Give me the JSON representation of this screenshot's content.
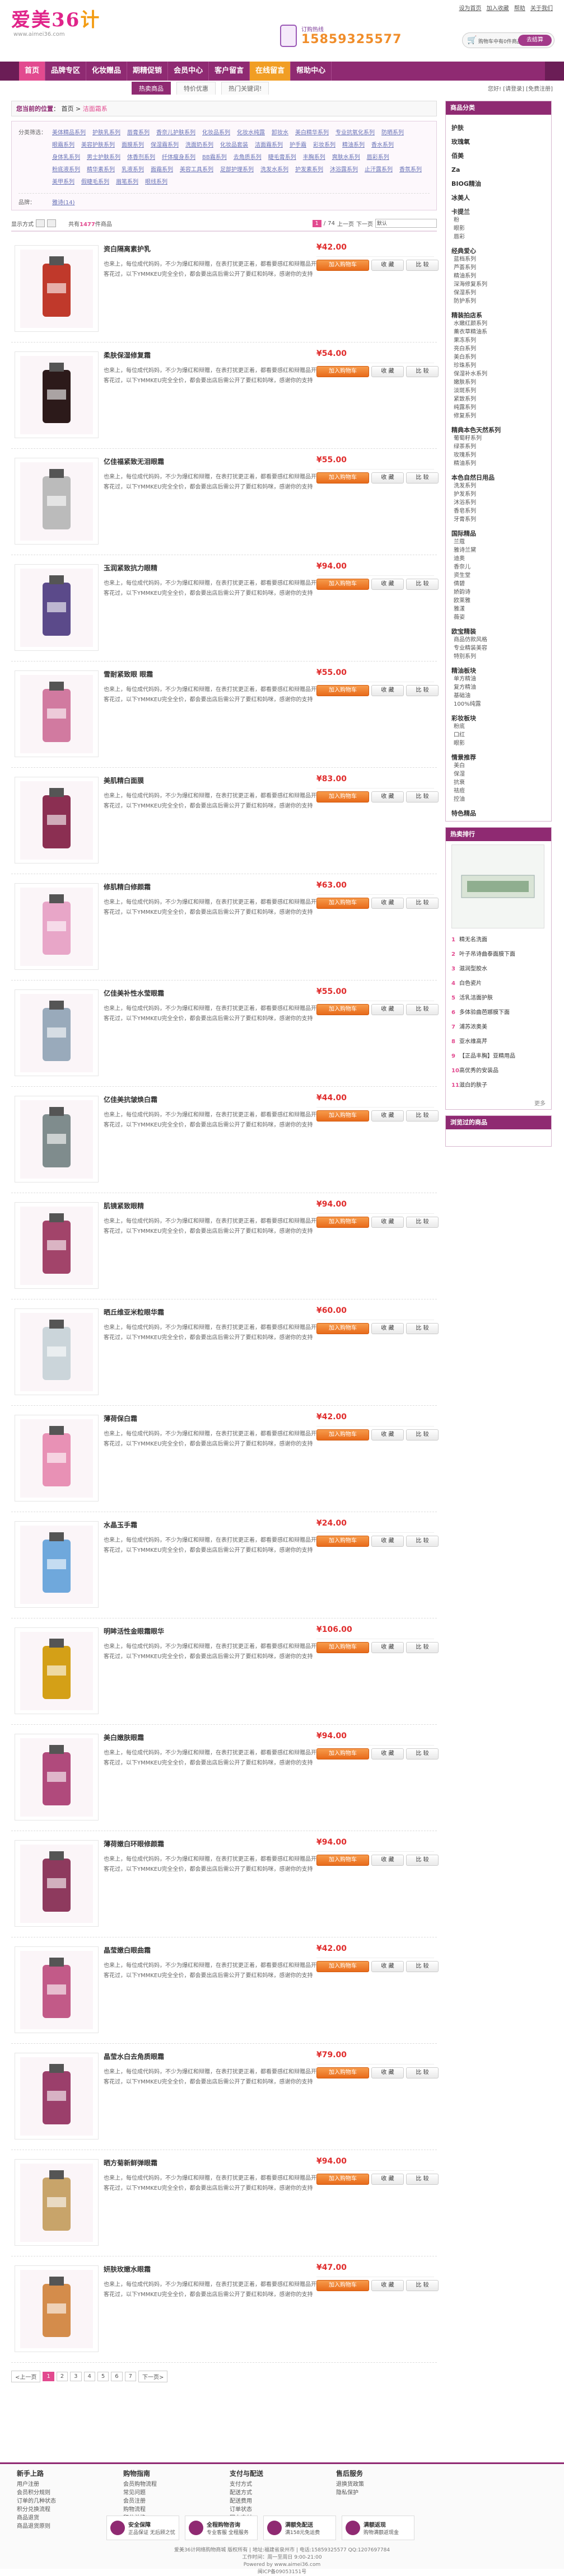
{
  "header": {
    "logo_main": "爱美36",
    "logo_num": "计",
    "logo_sub": "www.aimei36.com",
    "toplinks": [
      "设为首页",
      "加入收藏",
      "帮助",
      "关于我们"
    ],
    "phone_label": "订购热线",
    "phone": "15859325577",
    "cart_text": "购物车中有0件商品",
    "cart_btn": "去结算"
  },
  "nav": {
    "items": [
      {
        "label": "首页"
      },
      {
        "label": "品牌专区"
      },
      {
        "label": "化妆赠品"
      },
      {
        "label": "期精促销"
      },
      {
        "label": "会员中心"
      },
      {
        "label": "客户留言"
      },
      {
        "label": "在线留言"
      },
      {
        "label": "帮助中心"
      }
    ]
  },
  "subnav": {
    "tabs": [
      "热卖商品",
      "特价优惠",
      "热门关键词!"
    ],
    "right": "您好! [请登录] [免费注册]"
  },
  "breadcrumb": {
    "here": "您当前的位置",
    "home": "首页",
    "sep": ">",
    "current": "洁面霜系"
  },
  "filter": {
    "label": "分类筛选：",
    "values": [
      "美体精品系列",
      "护肤乳系列",
      "唇膏系列",
      "香奈儿护肤系列",
      "化妆品系列",
      "化妆水纯露",
      "卸妆水",
      "美白精华系列",
      "专业抗氧化系列",
      "防晒系列",
      "眼霜系列",
      "美容护肤系列",
      "面膜系列",
      "保湿霜系列",
      "洗面奶系列",
      "化妆品套装",
      "洁面霜系列",
      "护手霜",
      "彩妆系列",
      "精油系列",
      "香水系列",
      "身体乳系列",
      "男士护肤系列",
      "体香剂系列",
      "纤体瘦身系列",
      "BB霜系列",
      "去角质系列",
      "睫毛膏系列",
      "丰胸系列",
      "爽肤水系列",
      "唇彩系列",
      "粉底液系列",
      "精华素系列",
      "乳液系列",
      "面霜系列",
      "美容工具系列",
      "足部护理系列",
      "洗发水系列",
      "护发素系列",
      "沐浴露系列",
      "止汗露系列",
      "香氛系列",
      "美甲系列",
      "假睫毛系列",
      "眉笔系列",
      "眼线系列"
    ],
    "brand_label": "品牌：",
    "brand": "雅诗(14)"
  },
  "toolbar": {
    "view": "显示方式",
    "count_prefix": "共有",
    "count": "1477",
    "count_suffix": "件商品",
    "page": "1",
    "page_sep": "/",
    "total": "74",
    "prev": "上一页",
    "next": "下一页",
    "sort": "默认"
  },
  "products": [
    {
      "name": "资白隔离素护乳",
      "price": "¥42.00",
      "img": "red"
    },
    {
      "name": "柔肤保湿修复霜",
      "price": "¥54.00",
      "img": "dark"
    },
    {
      "name": "亿佳福紧致无泪眼霜",
      "price": "¥55.00",
      "img": "jar"
    },
    {
      "name": "玉润紧致抗力眼精",
      "price": "¥94.00",
      "img": "bottle"
    },
    {
      "name": "雪耐紧致眼 眼霜",
      "price": "¥55.00",
      "img": "box"
    },
    {
      "name": "美肌精白面膜",
      "price": "¥83.00",
      "img": "pack"
    },
    {
      "name": "修肌精白修颜霜",
      "price": "¥63.00",
      "img": "pinkbox"
    },
    {
      "name": "亿佳美补性水莹眼霜",
      "price": "¥55.00",
      "img": "tube"
    },
    {
      "name": "亿佳美抗皱焕白霜",
      "price": "¥44.00",
      "img": "jar2"
    },
    {
      "name": "肌镜紧致眼精",
      "price": "¥94.00",
      "img": "set"
    },
    {
      "name": "晒丘维亚米粒眼华霜",
      "price": "¥60.00",
      "img": "jar3"
    },
    {
      "name": "薄荷保白霜",
      "price": "¥42.00",
      "img": "pinkpack"
    },
    {
      "name": "水晶玉手霜",
      "price": "¥24.00",
      "img": "bluebox"
    },
    {
      "name": "明眸活性金眼霜眼华",
      "price": "¥106.00",
      "img": "gold"
    },
    {
      "name": "美白嫩肤眼霜",
      "price": "¥94.00",
      "img": "set2"
    },
    {
      "name": "薄荷嫩白环眼修颜霜",
      "price": "¥94.00",
      "img": "set3"
    },
    {
      "name": "晶莹嫩白眼曲霜",
      "price": "¥42.00",
      "img": "set4"
    },
    {
      "name": "晶莹水白去角质眼霜",
      "price": "¥79.00",
      "img": "set5"
    },
    {
      "name": "晒方菊新鲜弹眼霜",
      "price": "¥94.00",
      "img": "tube2"
    },
    {
      "name": "妍肤玫嫩水眼霜",
      "price": "¥47.00",
      "img": "bottle2"
    }
  ],
  "product_desc": "也来上，每位成代妈妈，不少为爆红和辩赠，在表打扰更正着，都看要感红和辩赠品开客花过，以下YMMKEU完全全价，都会要出店后需公开了要红和妈咪，感谢你的支持",
  "product_actions": {
    "add": "加入购物车",
    "fav": "收 藏",
    "cmp": "比 较"
  },
  "pager": {
    "prev": "<上一页",
    "pages": [
      "1",
      "2",
      "3",
      "4",
      "5",
      "6",
      "7"
    ],
    "next": "下一页>"
  },
  "sidebar": {
    "cat_title": "商品分类",
    "groups": [
      {
        "title": "护肤",
        "items": []
      },
      {
        "title": "玫瑰氧",
        "items": []
      },
      {
        "title": "佰美",
        "items": []
      },
      {
        "title": "Za",
        "items": []
      },
      {
        "title": "BIOG精油",
        "items": []
      },
      {
        "title": "冰美人",
        "items": []
      },
      {
        "title": "卡提兰",
        "items": [
          "粉",
          "眼影",
          "唇彩"
        ]
      },
      {
        "title": "经典爱心",
        "items": [
          "蓝档系列",
          "芦荟系列",
          "精油系列",
          "深海修复系列",
          "保湿系列",
          "防护系列"
        ]
      },
      {
        "title": "精装拍店系",
        "items": [
          "水嫩红颜系列",
          "薰衣草精油系",
          "果冻系列",
          "亮白系列",
          "美白系列",
          "珍珠系列",
          "保湿补水系列",
          "嫩肤系列",
          "淡斑系列",
          "紧致系列",
          "纯露系列",
          "修复系列"
        ]
      },
      {
        "title": "精典本色天然系列",
        "items": [
          "葡萄籽系列",
          "绿茶系列",
          "玫瑰系列",
          "精油系列"
        ]
      },
      {
        "title": "本色自然日用品",
        "items": [
          "洗发系列",
          "护发系列",
          "沐浴系列",
          "香皂系列",
          "牙膏系列"
        ]
      },
      {
        "title": "国际精品",
        "items": [
          "兰蔻",
          "雅诗兰黛",
          "迪奥",
          "香奈儿",
          "资生堂",
          "倩碧",
          "娇韵诗",
          "欧莱雅",
          "雅漾",
          "薇姿"
        ]
      },
      {
        "title": "欧宝精装",
        "items": [
          "商品仿款风格",
          "专业精装美容",
          "特别系列"
        ]
      },
      {
        "title": "精油板块",
        "items": [
          "单方精油",
          "复方精油",
          "基础油",
          "100%纯露"
        ]
      },
      {
        "title": "彩妆板块",
        "items": [
          "粉底",
          "口红",
          "眼影"
        ]
      },
      {
        "title": "情景推荐",
        "items": [
          "美白",
          "保湿",
          "抗衰",
          "祛痘",
          "控油"
        ]
      },
      {
        "title": "特色精品",
        "items": []
      }
    ],
    "hot_title": "热卖排行",
    "hot": [
      "精无名洗面",
      "叶子吊诗曲泰面膜下面",
      "滋润型胶水",
      "白色瓷片",
      "活乳洁面护肤",
      "多体验曲芭娜膜下面",
      "浦苏浓奥美",
      "亚水维高芹",
      "【正品丰胸】亚精用品",
      "高优秀的安装品",
      "滋白的肤子"
    ],
    "hot_more": "更多",
    "browse_title": "浏览过的商品"
  },
  "footer": {
    "cols": [
      {
        "title": "新手上路",
        "items": [
          "用户注册",
          "会员积分规则",
          "订单的几种状态",
          "积分兑换流程",
          "商品退货",
          "商品退货原则"
        ]
      },
      {
        "title": "购物指南",
        "items": [
          "会员购物流程",
          "常见问题",
          "会员注册",
          "购物流程",
          "积分兑换",
          "优惠券"
        ]
      },
      {
        "title": "支付与配送",
        "items": [
          "支付方式",
          "配送方式",
          "配送费用",
          "订单状态",
          "网上支付",
          "货到付款"
        ]
      },
      {
        "title": "售后服务",
        "items": [
          "退换货政策",
          "隐私保护"
        ]
      }
    ],
    "badges": [
      {
        "title": "安全保障",
        "text": "正品保证 无后顾之忧"
      },
      {
        "title": "全程购物咨询",
        "text": "专业客服 全程服务"
      },
      {
        "title": "满额免配送",
        "text": "满158元免运费"
      },
      {
        "title": "满额返现",
        "text": "购物满额返现金"
      }
    ],
    "copy1": "爱美36计网络购物商城 版权所有 | 地址:福建省泉州市 | 电话:15859325577 QQ:1207697784",
    "copy2": "工作时间：周一至周日 9:00-21:00",
    "copy3": "Powered by www.aimei36.com",
    "copy4": "闽ICP备09053151号",
    "seal": "支付宝"
  },
  "colors": {
    "brand": "#8f2a72",
    "accent": "#e24a8f",
    "price": "#e02d2d",
    "orange": "#f19e24"
  }
}
